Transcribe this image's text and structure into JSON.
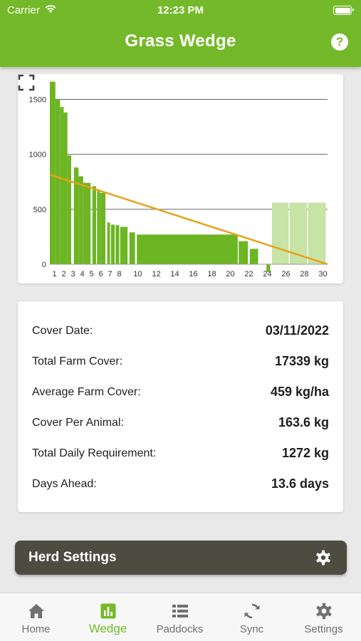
{
  "status_bar": {
    "carrier": "Carrier",
    "time": "12:23 PM"
  },
  "header": {
    "title": "Grass Wedge",
    "help_icon": "?"
  },
  "colors": {
    "brand_green": "#74b929",
    "bar_green": "#6cb523",
    "forecast_green": "#c7e3a6",
    "trend_line": "#e8a317",
    "herd_bar": "#4c4c41"
  },
  "chart_data": {
    "type": "bar",
    "y_ticks": [
      "0",
      "500",
      "1000",
      "1500"
    ],
    "x_ticks": [
      "1",
      "2",
      "3",
      "4",
      "5",
      "6",
      "7",
      "8",
      "10",
      "12",
      "14",
      "16",
      "18",
      "20",
      "22",
      "24",
      "26",
      "28",
      "30"
    ],
    "ylim": [
      0,
      1600
    ],
    "grid": true,
    "bars": [
      {
        "x0": 0.0,
        "x1": 0.6,
        "value": 1660
      },
      {
        "x0": 0.6,
        "x1": 1.1,
        "value": 1500
      },
      {
        "x0": 1.1,
        "x1": 1.5,
        "value": 1430
      },
      {
        "x0": 1.5,
        "x1": 1.9,
        "value": 1380
      },
      {
        "x0": 1.9,
        "x1": 2.3,
        "value": 990
      },
      {
        "x0": 2.6,
        "x1": 3.1,
        "value": 880
      },
      {
        "x0": 3.1,
        "x1": 3.6,
        "value": 800
      },
      {
        "x0": 3.6,
        "x1": 4.4,
        "value": 740
      },
      {
        "x0": 4.6,
        "x1": 5.0,
        "value": 710
      },
      {
        "x0": 5.1,
        "x1": 5.4,
        "value": 680
      },
      {
        "x0": 5.4,
        "x1": 6.0,
        "value": 650
      },
      {
        "x0": 6.2,
        "x1": 6.5,
        "value": 380
      },
      {
        "x0": 6.6,
        "x1": 7.0,
        "value": 360
      },
      {
        "x0": 7.1,
        "x1": 7.5,
        "value": 355
      },
      {
        "x0": 7.6,
        "x1": 8.4,
        "value": 340
      },
      {
        "x0": 8.6,
        "x1": 9.2,
        "value": 290
      },
      {
        "x0": 9.4,
        "x1": 20.3,
        "value": 270
      },
      {
        "x0": 20.4,
        "x1": 21.4,
        "value": 210
      },
      {
        "x0": 21.6,
        "x1": 22.5,
        "value": 140
      },
      {
        "x0": 23.4,
        "x1": 23.8,
        "value": -70
      }
    ],
    "forecast_bars": [
      {
        "x0": 24.0,
        "x1": 25.8,
        "value": 560
      },
      {
        "x0": 25.9,
        "x1": 27.8,
        "value": 560
      },
      {
        "x0": 27.9,
        "x1": 29.8,
        "value": 560
      }
    ],
    "trend_line": {
      "x": [
        0,
        30
      ],
      "y": [
        815,
        0
      ]
    }
  },
  "stats": [
    {
      "label": "Cover Date:",
      "value": "03/11/2022"
    },
    {
      "label": "Total Farm Cover:",
      "value": "17339 kg"
    },
    {
      "label": "Average Farm Cover:",
      "value": "459 kg/ha"
    },
    {
      "label": "Cover Per Animal:",
      "value": "163.6 kg"
    },
    {
      "label": "Total Daily Requirement:",
      "value": "1272 kg"
    },
    {
      "label": "Days Ahead:",
      "value": "13.6 days"
    }
  ],
  "herd_settings": {
    "label": "Herd Settings",
    "icon": "gear-icon"
  },
  "tabs": [
    {
      "label": "Home",
      "icon": "home-icon",
      "active": false
    },
    {
      "label": "Wedge",
      "icon": "bar-chart-icon",
      "active": true
    },
    {
      "label": "Paddocks",
      "icon": "list-icon",
      "active": false
    },
    {
      "label": "Sync",
      "icon": "sync-icon",
      "active": false
    },
    {
      "label": "Settings",
      "icon": "gear-icon",
      "active": false
    }
  ]
}
